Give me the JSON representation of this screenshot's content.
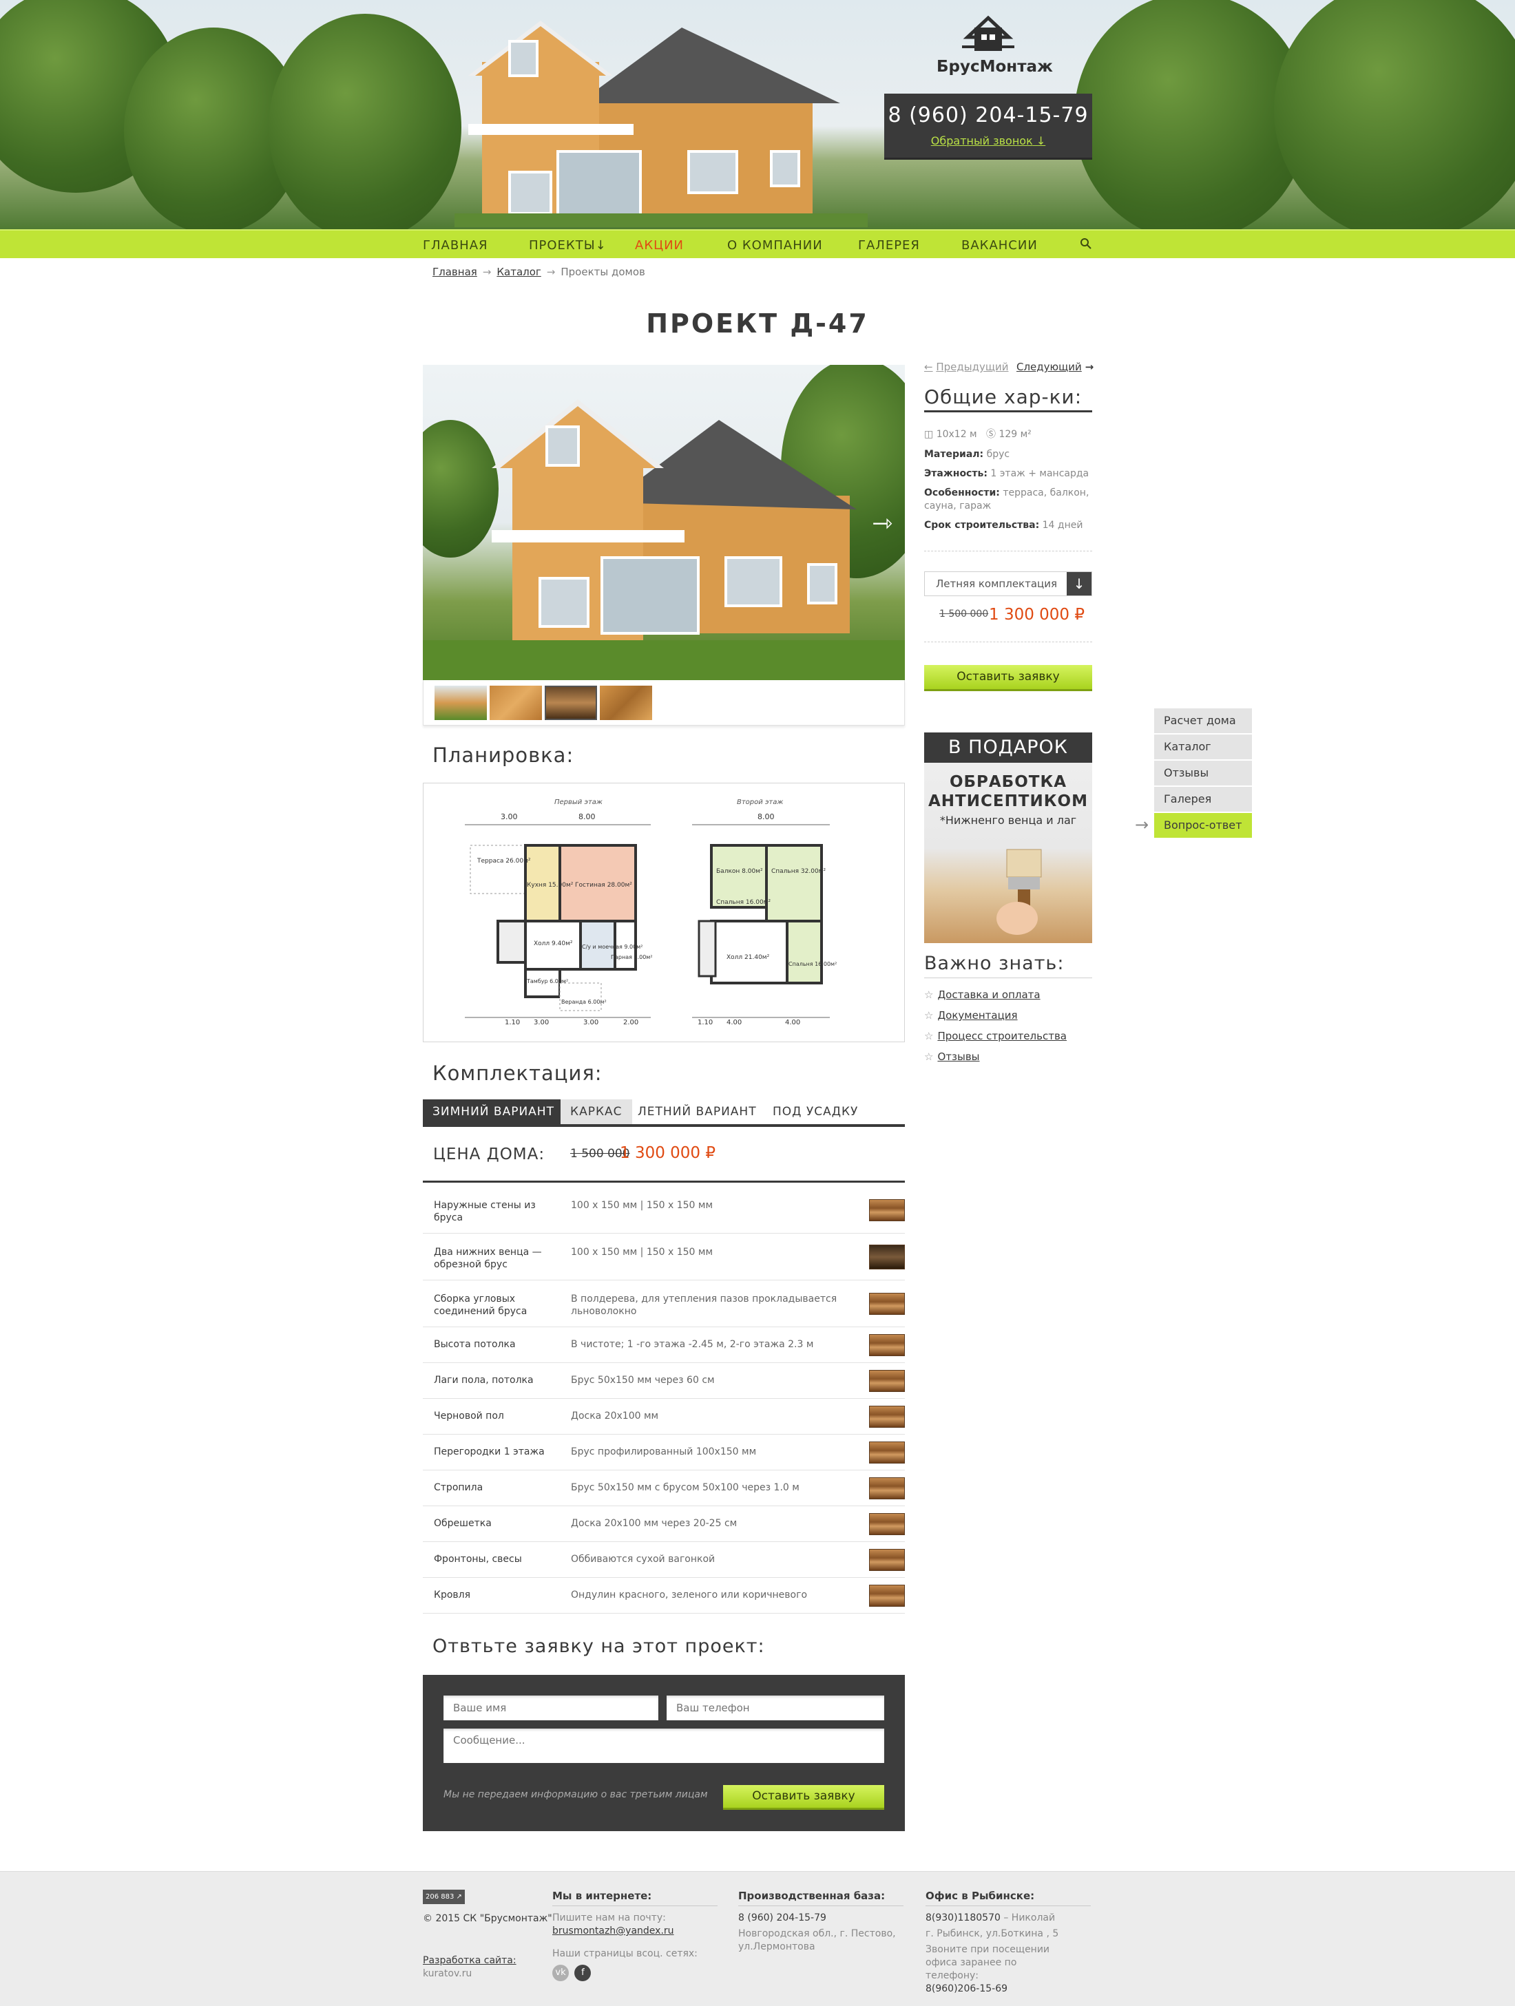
{
  "header": {
    "logo_text": "БрусМонтаж",
    "phone": "8 (960) 204-15-79",
    "callback": "Обратный звонок"
  },
  "nav": {
    "items": [
      "ГЛАВНАЯ",
      "ПРОЕКТЫ",
      "АКЦИИ",
      "О КОМПАНИИ",
      "ГАЛЕРЕЯ",
      "ВАКАНСИИ"
    ],
    "active": "АКЦИИ"
  },
  "breadcrumb": {
    "home": "Главная",
    "catalog": "Каталог",
    "current": "Проекты домов"
  },
  "title": "ПРОЕКТ Д-47",
  "pager": {
    "prev": "Предыдущий",
    "next": "Следующий"
  },
  "characteristics": {
    "title": "Общие хар-ки:",
    "size": "10x12 м",
    "area": "129 м²",
    "material_label": "Материал:",
    "material": "брус",
    "floors_label": "Этажность:",
    "floors": "1 этаж + мансарда",
    "features_label": "Особенности:",
    "features": "терраса, балкон, сауна, гараж",
    "term_label": "Срок строительства:",
    "term": "14 дней"
  },
  "config_select": "Летняя комплектация",
  "side_price": {
    "old": "1 500 000",
    "new": "1 300 000 ₽"
  },
  "side_button": "Оставить заявку",
  "gift": {
    "head": "В ПОДАРОК",
    "line1": "ОБРАБОТКА",
    "line2": "АНТИСЕПТИКОМ",
    "line3": "*Нижненго венца и лаг"
  },
  "know": {
    "title": "Важно знать:",
    "links": [
      "Доставка и оплата",
      "Документация",
      "Процесс строительства",
      "Отзывы"
    ]
  },
  "sidemenu": {
    "items": [
      "Расчет дома",
      "Каталог",
      "Отзывы",
      "Галерея",
      "Вопрос-ответ"
    ],
    "active": "Вопрос-ответ"
  },
  "layout_section": {
    "title": "Планировка:",
    "floor1": "Первый этаж",
    "floor2": "Второй этаж",
    "rooms1": [
      "Терраса 26.00м²",
      "Кухня 15.00м²",
      "Гостиная 28.00м²",
      "Холл 9.40м²",
      "С/у и моечная 9.00м²",
      "Парная 6.00м²",
      "Тамбур 6.00м²",
      "Веранда 6.00м²"
    ],
    "rooms2": [
      "Балкон 8.00м²",
      "Спальня 32.00м²",
      "Спальня 16.00м²",
      "Холл 21.40м²",
      "Спальня 16.00м²"
    ],
    "dims_top": [
      "3.00",
      "8.00"
    ],
    "dims_bottom1": [
      "1.10",
      "3.00",
      "3.00",
      "2.00"
    ],
    "dims_bottom2": [
      "1.10",
      "4.00",
      "4.00"
    ]
  },
  "equipment": {
    "title": "Комплектация:",
    "tabs": [
      "ЗИМНИЙ ВАРИАНТ",
      "КАРКАС",
      "ЛЕТНИЙ ВАРИАНТ",
      "ПОД УСАДКУ"
    ],
    "active_tab": "ЗИМНИЙ ВАРИАНТ",
    "price_label": "ЦЕНА ДОМА:",
    "old_price": "1 500 000",
    "new_price": "1 300 000 ₽",
    "rows": [
      {
        "name": "Наружные стены из бруса",
        "value": "100 х 150 мм | 150 х 150 мм"
      },
      {
        "name": "Два нижних венца — обрезной брус",
        "value": "100 х 150 мм | 150 х 150 мм"
      },
      {
        "name": "Сборка угловых соединений бруса",
        "value": "В полдерева, для утепления пазов прокладывается льноволокно"
      },
      {
        "name": "Высота потолка",
        "value": "В чистоте; 1 -го этажа -2.45 м, 2-го этажа 2.3 м"
      },
      {
        "name": "Лаги пола, потолка",
        "value": "Брус 50х150 мм через 60 см"
      },
      {
        "name": "Черновой пол",
        "value": "Доска 20х100 мм"
      },
      {
        "name": "Перегородки 1 этажа",
        "value": "Брус профилированный 100х150 мм"
      },
      {
        "name": "Стропила",
        "value": "Брус 50х150 мм с брусом 50х100 через 1.0 м"
      },
      {
        "name": "Обрешетка",
        "value": "Доска 20х100 мм через 20-25 см"
      },
      {
        "name": "Фронтоны, свесы",
        "value": "Оббиваются сухой вагонкой"
      },
      {
        "name": "Кровля",
        "value": "Ондулин красного, зеленого или коричневого"
      }
    ]
  },
  "request_form": {
    "title": "Отвтьте заявку на этот проект:",
    "name_placeholder": "Ваше имя",
    "phone_placeholder": "Ваш телефон",
    "message_placeholder": "Сообщение...",
    "note": "Мы не передаем информацию о вас третьим лицам",
    "button": "Оставить заявку"
  },
  "footer": {
    "counter": "206 883",
    "copyright": "© 2015 СК \"Брусмонтаж\"",
    "dev_label": "Разработка сайта:",
    "dev_site": "kuratov.ru",
    "online_title": "Мы в интернете:",
    "mail_label": "Пишите нам на почту:",
    "email": "brusmontazh@yandex.ru",
    "social_label": "Наши страницы всоц. сетях:",
    "base_title": "Производственная база:",
    "base_phone": "8 (960) 204-15-79",
    "base_addr1": "Новгородская обл., г. Пестово,",
    "base_addr2": "ул.Лермонтова",
    "office_title": "Офис в Рыбинске:",
    "office_phone1": "8(930)1180570",
    "office_person": " – Николай",
    "office_addr": "г. Рыбинск, ул.Боткина , 5",
    "office_note": "Звоните при посещении офиса заранее по телефону:",
    "office_phone2": "8(960)206-15-69"
  }
}
